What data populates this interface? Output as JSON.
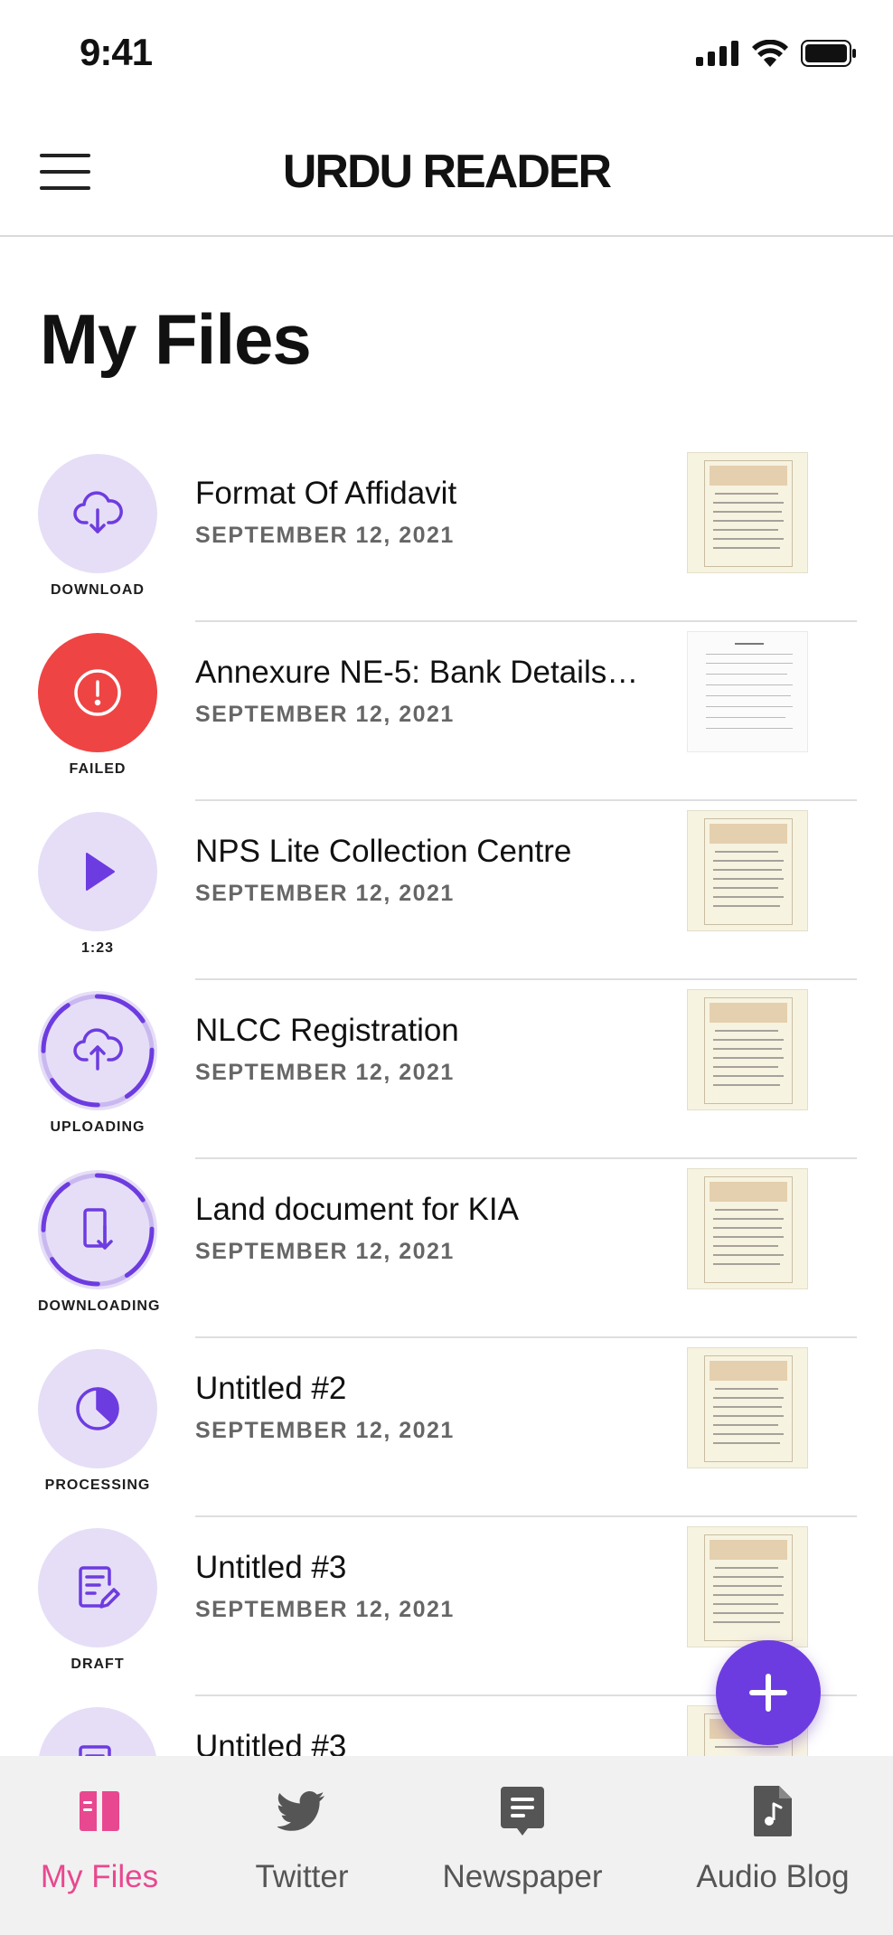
{
  "status_bar": {
    "time": "9:41"
  },
  "header": {
    "title": "URDU READER"
  },
  "page": {
    "title": "My Files"
  },
  "files": [
    {
      "name": "Format Of Affidavit",
      "date": "SEPTEMBER 12, 2021",
      "status": "DOWNLOAD",
      "status_icon": "cloud-download-icon"
    },
    {
      "name": "Annexure NE-5: Bank Details…",
      "date": "SEPTEMBER 12, 2021",
      "status": "FAILED",
      "status_icon": "alert-icon"
    },
    {
      "name": "NPS Lite Collection Centre",
      "date": "SEPTEMBER 12, 2021",
      "status": "1:23",
      "status_icon": "play-icon"
    },
    {
      "name": "NLCC Registration",
      "date": "SEPTEMBER 12, 2021",
      "status": "UPLOADING",
      "status_icon": "cloud-upload-icon"
    },
    {
      "name": "Land document for KIA",
      "date": "SEPTEMBER 12, 2021",
      "status": "DOWNLOADING",
      "status_icon": "file-download-icon"
    },
    {
      "name": "Untitled #2",
      "date": "SEPTEMBER 12, 2021",
      "status": "PROCESSING",
      "status_icon": "pie-chart-icon"
    },
    {
      "name": "Untitled #3",
      "date": "SEPTEMBER 12, 2021",
      "status": "DRAFT",
      "status_icon": "edit-document-icon"
    },
    {
      "name": "Untitled #3",
      "date": "",
      "status": "",
      "status_icon": "edit-document-icon"
    }
  ],
  "fab": {
    "icon": "plus-icon"
  },
  "bottom_nav": [
    {
      "label": "My Files",
      "icon": "book-icon",
      "active": true
    },
    {
      "label": "Twitter",
      "icon": "twitter-icon",
      "active": false
    },
    {
      "label": "Newspaper",
      "icon": "newspaper-icon",
      "active": false
    },
    {
      "label": "Audio Blog",
      "icon": "audio-file-icon",
      "active": false
    }
  ],
  "colors": {
    "accent": "#6d3ce0",
    "status_bg": "#e6def7",
    "failed": "#ef4444",
    "nav_active": "#e8488f"
  }
}
